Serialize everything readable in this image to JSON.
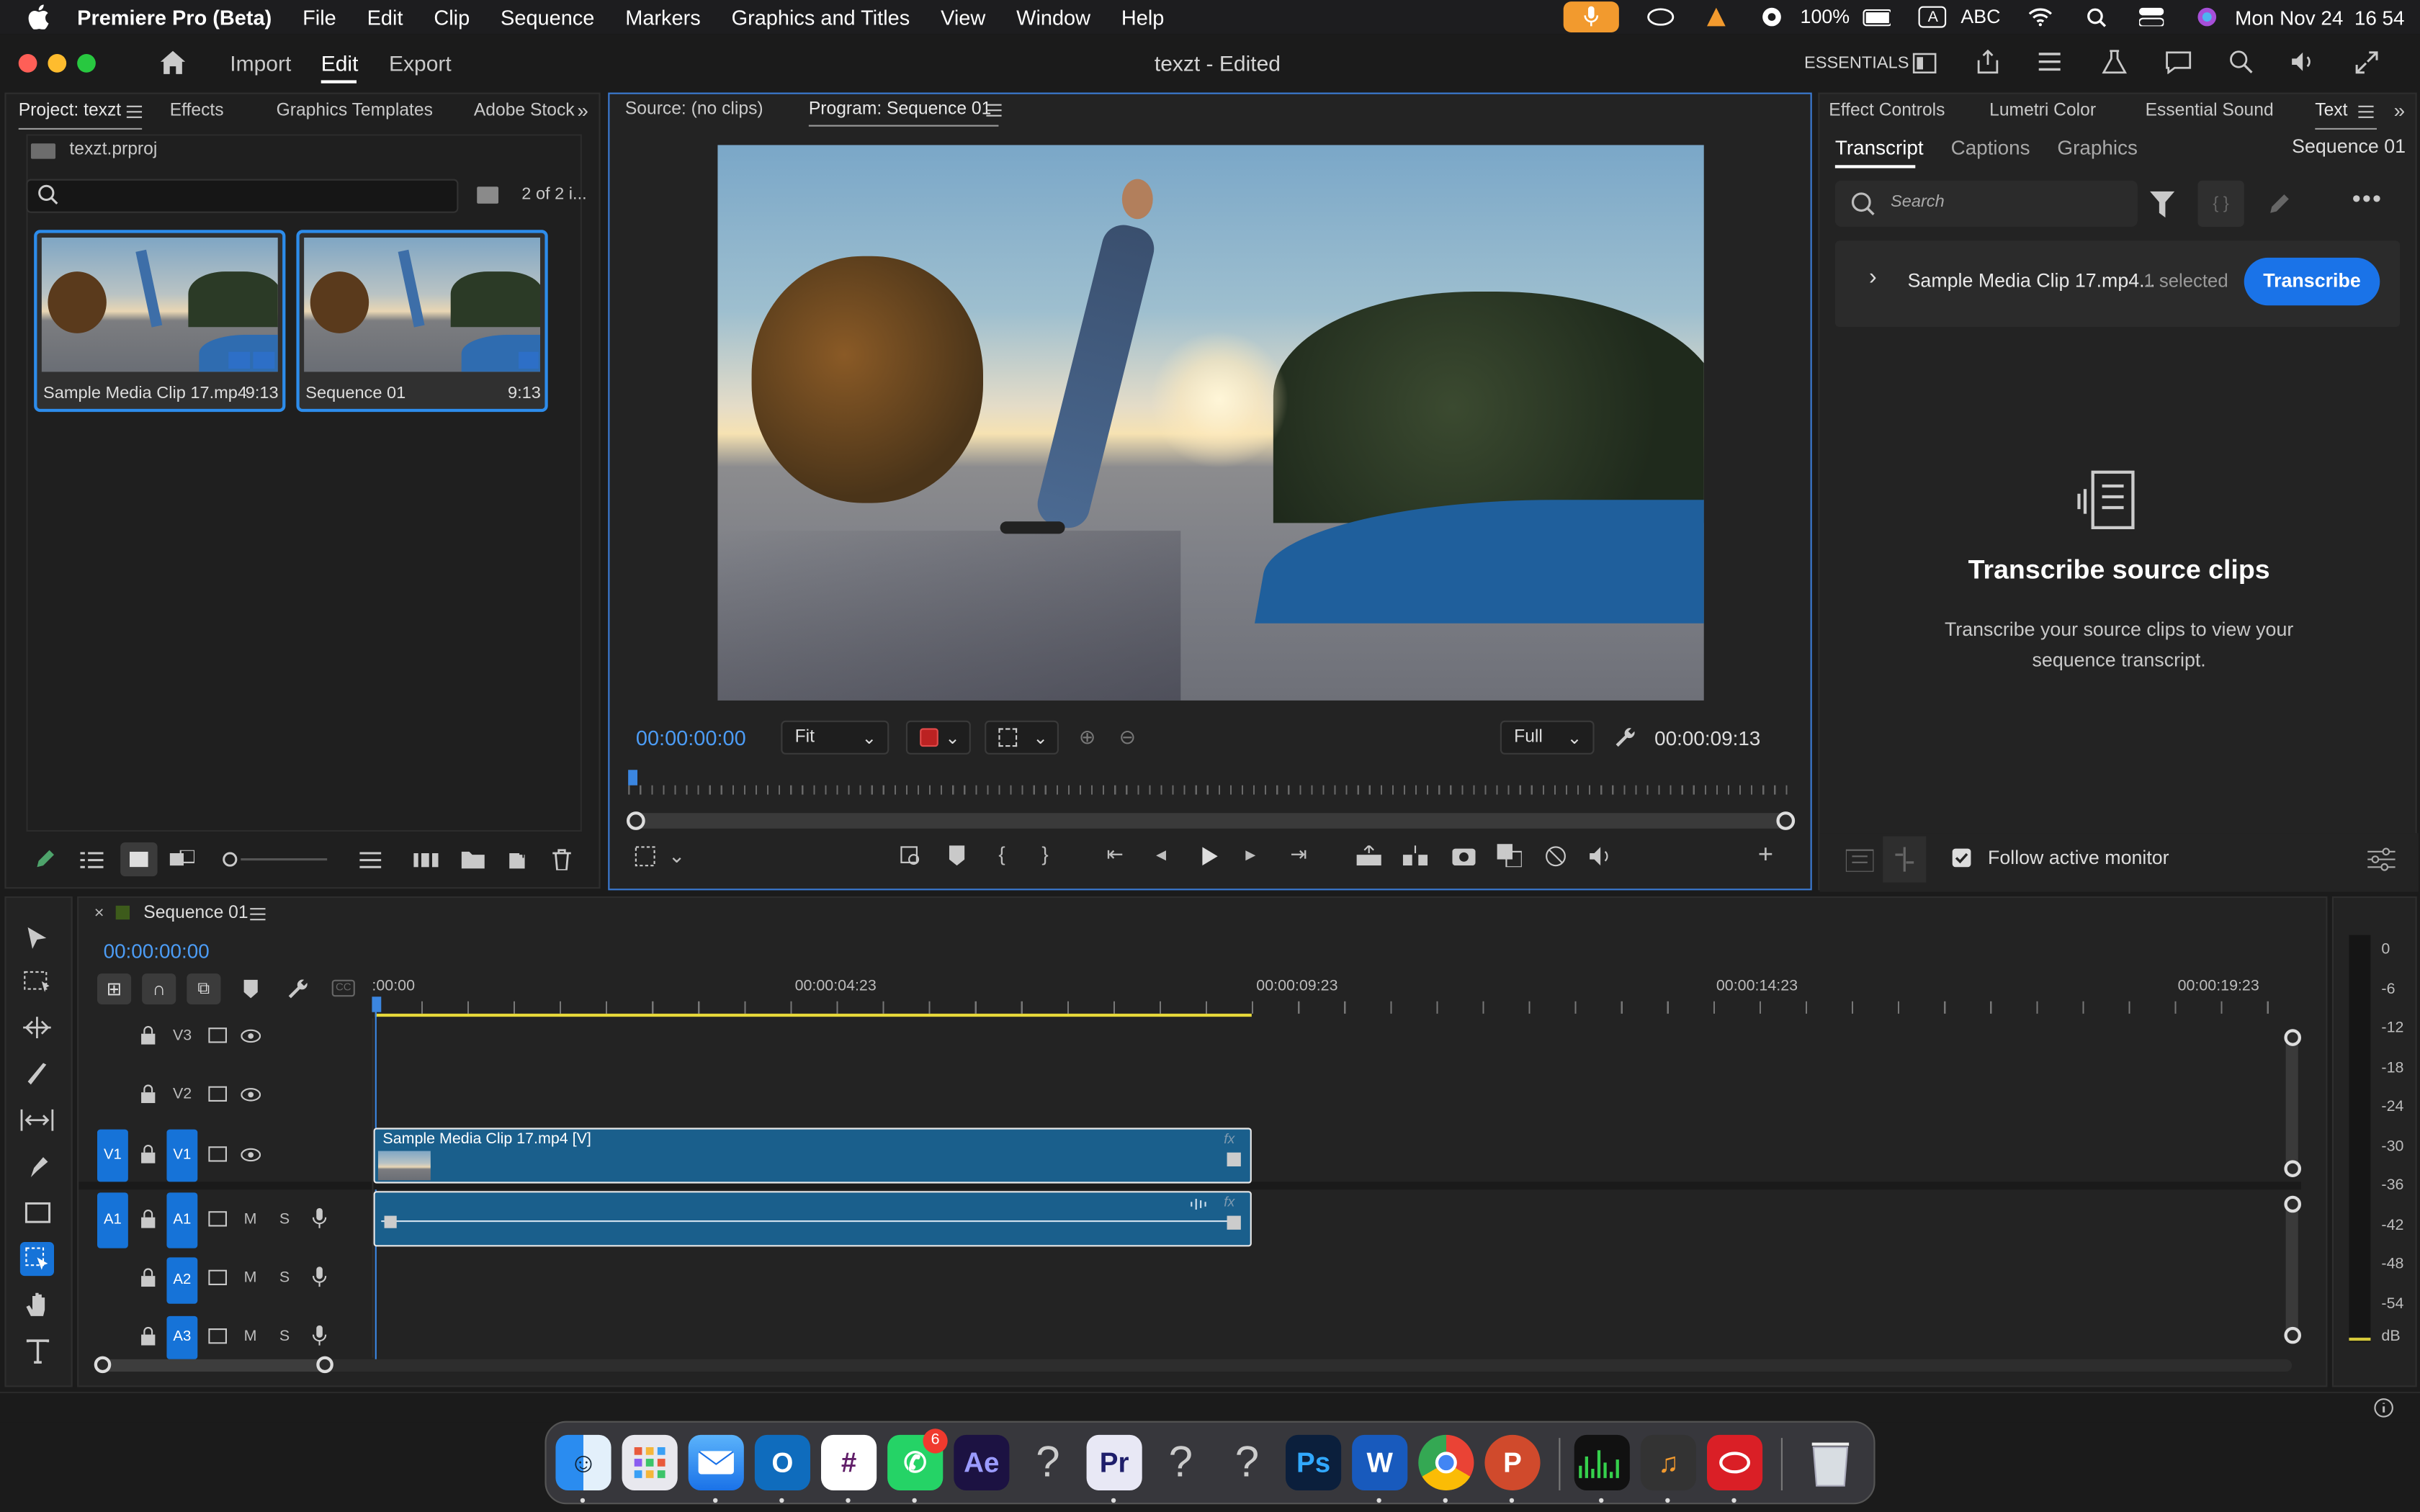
{
  "menubar": {
    "app_name": "Premiere Pro (Beta)",
    "items": [
      "File",
      "Edit",
      "Clip",
      "Sequence",
      "Markers",
      "Graphics and Titles",
      "View",
      "Window",
      "Help"
    ],
    "battery": "100%",
    "input": "ABC",
    "clock": "Mon Nov 24  16 54"
  },
  "topbar": {
    "nav": {
      "import": "Import",
      "edit": "Edit",
      "export": "Export"
    },
    "title": "texzt - Edited",
    "workspace": "ESSENTIALS"
  },
  "project_panel": {
    "tabs": [
      "Project: texzt",
      "Effects",
      "Graphics Templates",
      "Adobe Stock"
    ],
    "file": "texzt.prproj",
    "count": "2 of 2 i...",
    "items": [
      {
        "name": "Sample Media Clip 17.mp4",
        "duration": "9:13"
      },
      {
        "name": "Sequence 01",
        "duration": "9:13"
      }
    ]
  },
  "monitor": {
    "source_tab": "Source: (no clips)",
    "program_tab": "Program: Sequence 01",
    "timecode": "00:00:00:00",
    "fit": "Fit",
    "quality": "Full",
    "duration": "00:00:09:13"
  },
  "right_panel": {
    "tabs": [
      "Effect Controls",
      "Lumetri Color",
      "Essential Sound",
      "Text"
    ],
    "subtabs": [
      "Transcript",
      "Captions",
      "Graphics"
    ],
    "sequence": "Sequence 01",
    "search_placeholder": "Search",
    "clip_name": "Sample Media Clip 17.mp4...",
    "selected": "1 selected",
    "transcribe_button": "Transcribe",
    "heading": "Transcribe source clips",
    "body": "Transcribe your source clips to view your sequence transcript.",
    "follow_label": "Follow active monitor",
    "follow_checked": true
  },
  "timeline": {
    "sequence_tab": "Sequence 01",
    "timecode": "00:00:00:00",
    "ruler": [
      ":00:00",
      "00:00:04:23",
      "00:00:09:23",
      "00:00:14:23",
      "00:00:19:23"
    ],
    "tracks_video": [
      "V3",
      "V2",
      "V1"
    ],
    "tracks_audio": [
      "A1",
      "A2",
      "A3"
    ],
    "source_patch_v": "V1",
    "source_patch_a": "A1",
    "mute": "M",
    "solo": "S",
    "clip_label": "Sample Media Clip 17.mp4 [V]"
  },
  "meter": {
    "scale": [
      "0",
      "-6",
      "-12",
      "-18",
      "-24",
      "-30",
      "-36",
      "-42",
      "-48",
      "-54",
      "dB"
    ]
  },
  "dock": {
    "badge": "6",
    "apps": [
      "finder-icon",
      "launchpad-icon",
      "mail-icon",
      "outlook-icon",
      "slack-icon",
      "whatsapp-icon",
      "after-effects-icon",
      "unknown-app-icon",
      "premiere-icon",
      "unknown-app-icon",
      "unknown-app-icon",
      "photoshop-icon",
      "word-icon",
      "chrome-icon",
      "powerpoint-icon",
      "activity-monitor-icon",
      "garageband-icon",
      "creative-cloud-icon",
      "trash-icon"
    ],
    "labels": {
      "ae": "Ae",
      "pr": "Pr",
      "ps": "Ps",
      "unknown": "?"
    }
  },
  "colors": {
    "accent": "#2d8ceb",
    "panel": "#232323",
    "clip": "#1a5f8c",
    "track_blue": "#1673d8",
    "timecode": "#4c9cf5"
  }
}
